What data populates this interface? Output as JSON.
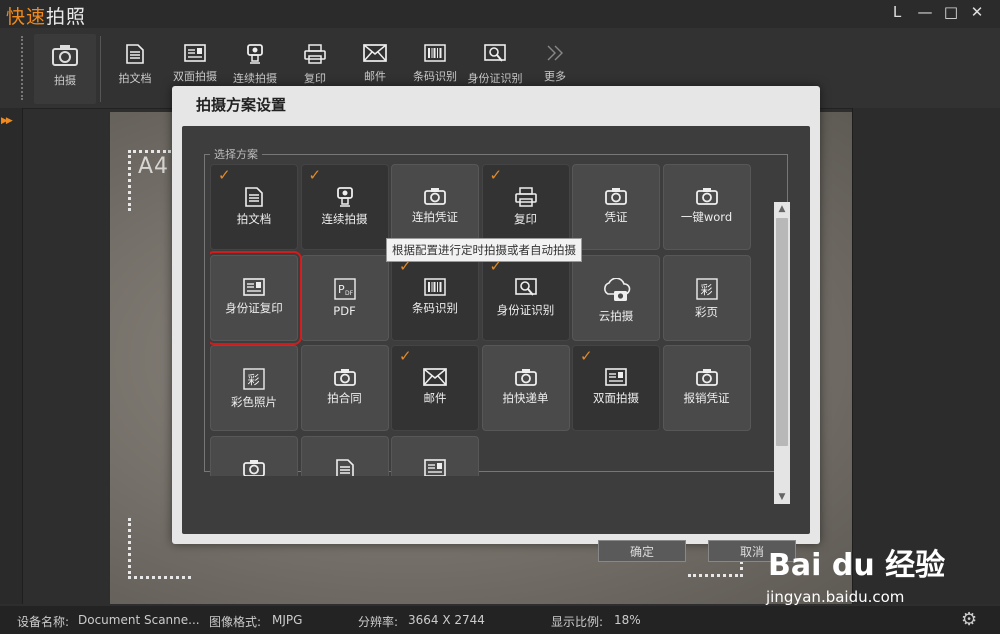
{
  "app": {
    "title_part1": "快速",
    "title_part2": "拍照"
  },
  "window_controls": {
    "min": "L",
    "minimize": "—",
    "maximize": "□",
    "close": "✕"
  },
  "toolbar": {
    "main_label": "拍摄",
    "items": [
      {
        "label": "拍文档",
        "icon": "document-icon"
      },
      {
        "label": "双面拍摄",
        "icon": "id-card-icon"
      },
      {
        "label": "连续拍摄",
        "icon": "continuous-camera-icon"
      },
      {
        "label": "复印",
        "icon": "copier-icon"
      },
      {
        "label": "邮件",
        "icon": "mail-icon"
      },
      {
        "label": "条码识别",
        "icon": "barcode-icon"
      },
      {
        "label": "身份证识别",
        "icon": "id-recognize-icon"
      },
      {
        "label": "更多",
        "icon": "double-chevron-right-icon"
      }
    ]
  },
  "preview": {
    "paper_label": "A4"
  },
  "dialog": {
    "title": "拍摄方案设置",
    "group_label": "选择方案",
    "tooltip": "根据配置进行定时拍摄或者自动拍摄",
    "ok_label": "确定",
    "cancel_label": "取消",
    "tiles": [
      {
        "label": "拍文档",
        "icon": "document-icon",
        "checked": true
      },
      {
        "label": "连续拍摄",
        "icon": "continuous-camera-icon",
        "checked": true
      },
      {
        "label": "连拍凭证",
        "icon": "camera-icon",
        "checked": false
      },
      {
        "label": "复印",
        "icon": "copier-icon",
        "checked": true
      },
      {
        "label": "凭证",
        "icon": "camera-icon",
        "checked": false
      },
      {
        "label": "一键word",
        "icon": "camera-icon",
        "checked": false
      },
      {
        "label": "身份证复印",
        "icon": "id-card-icon",
        "checked": false,
        "selected": true
      },
      {
        "label": "PDF",
        "icon": "pdf-icon",
        "checked": false
      },
      {
        "label": "条码识别",
        "icon": "barcode-icon",
        "checked": true
      },
      {
        "label": "身份证识别",
        "icon": "id-recognize-icon",
        "checked": true
      },
      {
        "label": "云拍摄",
        "icon": "cloud-camera-icon",
        "checked": false
      },
      {
        "label": "彩页",
        "icon": "color-page-icon",
        "checked": false
      },
      {
        "label": "彩色照片",
        "icon": "color-page-icon",
        "checked": false
      },
      {
        "label": "拍合同",
        "icon": "camera-icon",
        "checked": false
      },
      {
        "label": "邮件",
        "icon": "mail-icon",
        "checked": true
      },
      {
        "label": "拍快递单",
        "icon": "camera-icon",
        "checked": false
      },
      {
        "label": "双面拍摄",
        "icon": "id-card-icon",
        "checked": true
      },
      {
        "label": "报销凭证",
        "icon": "camera-icon",
        "checked": false
      },
      {
        "label": "",
        "icon": "camera-icon",
        "checked": false
      },
      {
        "label": "",
        "icon": "document-icon",
        "checked": false
      },
      {
        "label": "",
        "icon": "id-card-icon",
        "checked": false
      }
    ]
  },
  "status": {
    "device_label": "设备名称:",
    "device_value": "Document Scanne...",
    "format_label": "图像格式:",
    "format_value": "MJPG",
    "resolution_label": "分辨率:",
    "resolution_value": "3664 X 2744",
    "ratio_label": "显示比例:",
    "ratio_value": "18%"
  },
  "watermark": {
    "brand": "Bai du 经验",
    "url": "jingyan.baidu.com"
  },
  "colors": {
    "accent": "#f08a1e",
    "check": "#e08a2a",
    "selected_border": "#d21c1c"
  }
}
